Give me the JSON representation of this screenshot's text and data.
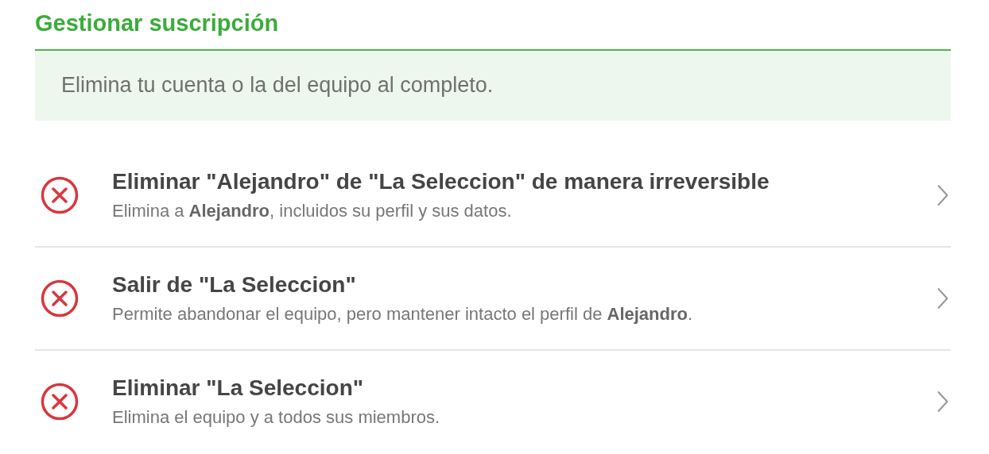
{
  "section_title": "Gestionar suscripción",
  "banner": {
    "text": "Elimina tu cuenta o la del equipo al completo."
  },
  "actions": [
    {
      "title": "Eliminar \"**Alejandro**\" de \"**La Seleccion**\" de manera irreversible",
      "description": "Elimina a **Alejandro**, incluidos su perfil y sus datos."
    },
    {
      "title": "Salir de \"**La Seleccion**\"",
      "description": "Permite abandonar el equipo, pero mantener intacto el perfil de **Alejandro**."
    },
    {
      "title": "Eliminar \"**La Seleccion**\"",
      "description": "Elimina el equipo y a todos sus miembros."
    }
  ]
}
